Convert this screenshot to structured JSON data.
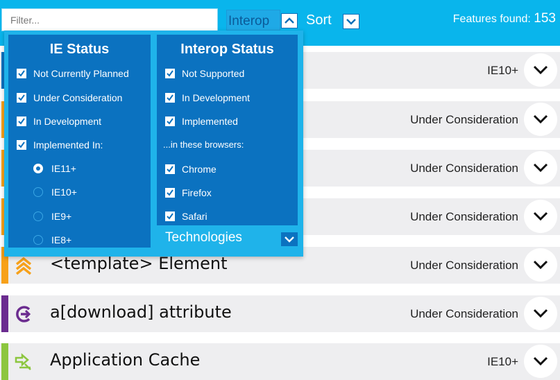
{
  "toolbar": {
    "filter_placeholder": "Filter...",
    "interop_label": "Interop",
    "sort_label": "Sort",
    "features_found_label": "Features found:",
    "features_found_count": "153"
  },
  "features": [
    {
      "title": "",
      "status": "IE10+",
      "stripe_color": "#0b72c0",
      "icon": ""
    },
    {
      "title": "",
      "status": "Under Consideration",
      "stripe_color": "#f7a11a",
      "icon": ""
    },
    {
      "title": "",
      "status": "Under Consideration",
      "stripe_color": "#f7a11a",
      "icon": ""
    },
    {
      "title": "",
      "status": "Under Consideration",
      "stripe_color": "#f7a11a",
      "icon": ""
    },
    {
      "title": "<template> Element",
      "status": "Under Consideration",
      "stripe_color": "#f7a11a",
      "icon": "chevrons-up-icon"
    },
    {
      "title": "a[download] attribute",
      "status": "Under Consideration",
      "stripe_color": "#6b2c8f",
      "icon": "download-arrow-icon"
    },
    {
      "title": "Application Cache",
      "status": "IE10+",
      "stripe_color": "#8cc63f",
      "icon": "cache-icon"
    }
  ],
  "dropdown": {
    "ie_status": {
      "heading": "IE Status",
      "checkboxes": [
        {
          "label": "Not Currently Planned",
          "checked": true
        },
        {
          "label": "Under Consideration",
          "checked": true
        },
        {
          "label": "In Development",
          "checked": true
        },
        {
          "label": "Implemented In:",
          "checked": true
        }
      ],
      "radios": [
        {
          "label": "IE11+",
          "selected": true
        },
        {
          "label": "IE10+",
          "selected": false
        },
        {
          "label": "IE9+",
          "selected": false
        },
        {
          "label": "IE8+",
          "selected": false
        }
      ]
    },
    "interop_status": {
      "heading": "Interop Status",
      "checkboxes": [
        {
          "label": "Not Supported",
          "checked": true
        },
        {
          "label": "In Development",
          "checked": true
        },
        {
          "label": "Implemented",
          "checked": true
        }
      ],
      "browsers_subheading": "...in these browsers:",
      "browsers": [
        {
          "label": "Chrome",
          "checked": true
        },
        {
          "label": "Firefox",
          "checked": true
        },
        {
          "label": "Safari",
          "checked": true
        }
      ]
    },
    "technologies_label": "Technologies"
  },
  "colors": {
    "topbar": "#09b5ec",
    "panel_bg": "#1fb3ea",
    "column_bg": "#0b72c0",
    "row_bg": "#eeeef0"
  }
}
